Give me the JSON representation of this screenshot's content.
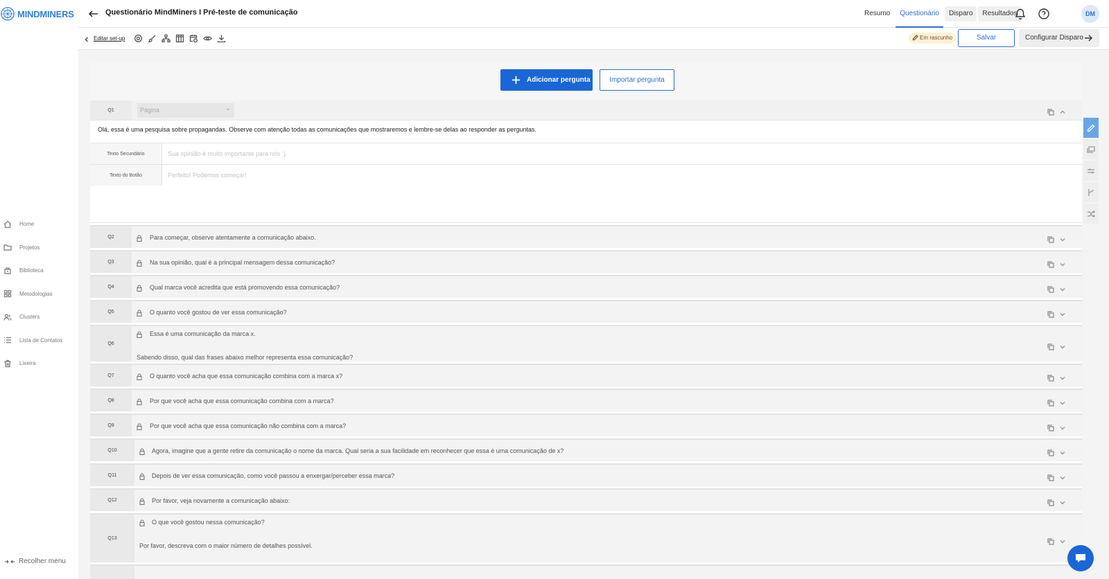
{
  "brand": {
    "name_bold": "MIND",
    "name_rest": "MINERS",
    "accent": "#2d6fd1",
    "button_blue": "#1a66d6"
  },
  "sidebar": {
    "items": [
      {
        "label": "Home",
        "icon": "home-icon"
      },
      {
        "label": "Projetos",
        "icon": "folder-icon"
      },
      {
        "label": "Biblioteca",
        "icon": "library-icon"
      },
      {
        "label": "Metodologias",
        "icon": "grid-icon"
      },
      {
        "label": "Clusters",
        "icon": "users-icon"
      },
      {
        "label": "Lista de Contatos",
        "icon": "list-icon"
      },
      {
        "label": "Lixeira",
        "icon": "trash-icon"
      }
    ],
    "collapse_label": "Recolher menu"
  },
  "header": {
    "title": "Questionário MindMiners I Pré-teste de comunicação",
    "tabs": [
      {
        "label": "Resumo",
        "active": false
      },
      {
        "label": "Questionário",
        "active": true
      },
      {
        "label": "Disparo",
        "active": false
      },
      {
        "label": "Resultados",
        "active": false
      }
    ],
    "avatar": "DM"
  },
  "toolbar": {
    "edit_setup": "Editar set-up",
    "status": "Em rascunho",
    "save": "Salvar",
    "configure": "Configurar Disparo"
  },
  "actions": {
    "add": "Adicionar pergunta",
    "import": "Importar pergunta"
  },
  "q1": {
    "number": "Q1",
    "type_select": "Página",
    "text": "Olá, essa é uma pesquisa sobre propagandas. Observe com atenção todas as comunicações que mostraremos e lembre-se delas ao responder as perguntas.",
    "secondary_label": "Texto Secundário",
    "secondary_placeholder": "Sua opinião é muito importante para nós :)",
    "button_label": "Texto do Botão",
    "button_placeholder": "Perfeito! Podemos começar!"
  },
  "questions": [
    {
      "number": "Q2",
      "text": "Para começar, observe atentamente a comunicação abaixo."
    },
    {
      "number": "Q3",
      "text": "Na sua opinião, qual é a principal mensagem dessa comunicação?"
    },
    {
      "number": "Q4",
      "text": "Qual marca você acredita que está promovendo essa comunicação?"
    },
    {
      "number": "Q5",
      "text": "O quanto você gostou de ver essa comunicação?"
    },
    {
      "number": "Q6",
      "text": "Essa é uma comunicação da marca x.",
      "text2": "Sabendo disso, qual das frases abaixo melhor representa essa comunicação?"
    },
    {
      "number": "Q7",
      "text": "O quanto você acha que essa comunicação combina com a marca x?"
    },
    {
      "number": "Q8",
      "text": "Por que você acha que essa comunicação combina com a marca?"
    },
    {
      "number": "Q9",
      "text": "Por que você acha que essa comunicação não combina com a marca?"
    },
    {
      "number": "Q10",
      "text": "Agora, imagine que a gente retire da comunicação o nome da marca. Qual seria a sua facilidade em reconhecer que essa é uma comunicação de x?"
    },
    {
      "number": "Q11",
      "text": "Depois de ver essa comunicação, como você passou a enxergar/perceber essa marca?"
    },
    {
      "number": "Q12",
      "text": "Por favor, veja novamente a comunicação abaixo:"
    },
    {
      "number": "Q13",
      "text": "O que você gostou nessa comunicação?",
      "text2": "Por favor, descreva com o maior número de detalhes possível."
    }
  ]
}
